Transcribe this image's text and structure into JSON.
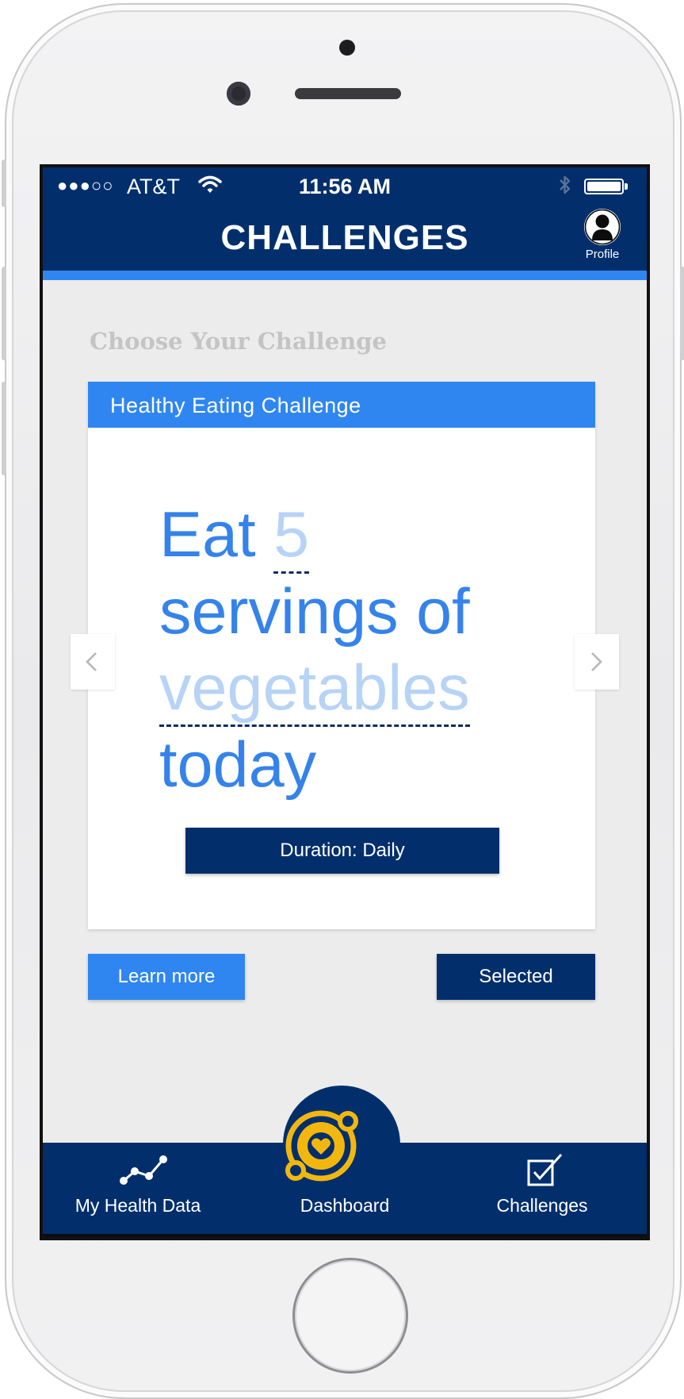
{
  "status_bar": {
    "signal": "●●●○○",
    "carrier": "AT&T",
    "time": "11:56 AM"
  },
  "nav": {
    "title": "CHALLENGES",
    "profile_label": "Profile"
  },
  "content": {
    "section_heading": "Choose Your Challenge",
    "card": {
      "title": "Healthy Eating Challenge",
      "goal_prefix": "Eat",
      "goal_quantity": "5",
      "goal_middle": "servings of",
      "goal_item": "vegetables",
      "goal_suffix": "today",
      "duration_label": "Duration: Daily"
    },
    "learn_more_label": "Learn more",
    "selected_label": "Selected"
  },
  "tabs": [
    {
      "label": "My Health Data",
      "icon": "line-graph-icon"
    },
    {
      "label": "Dashboard",
      "icon": "heart-orbit-icon"
    },
    {
      "label": "Challenges",
      "icon": "checkbox-icon"
    }
  ],
  "colors": {
    "navy": "#022f6c",
    "accent_blue": "#2f86f0",
    "goal_text": "#3583ea",
    "goal_variable": "#b7d3f6",
    "background": "#ececec",
    "dashboard_gold": "#f2b70f"
  }
}
